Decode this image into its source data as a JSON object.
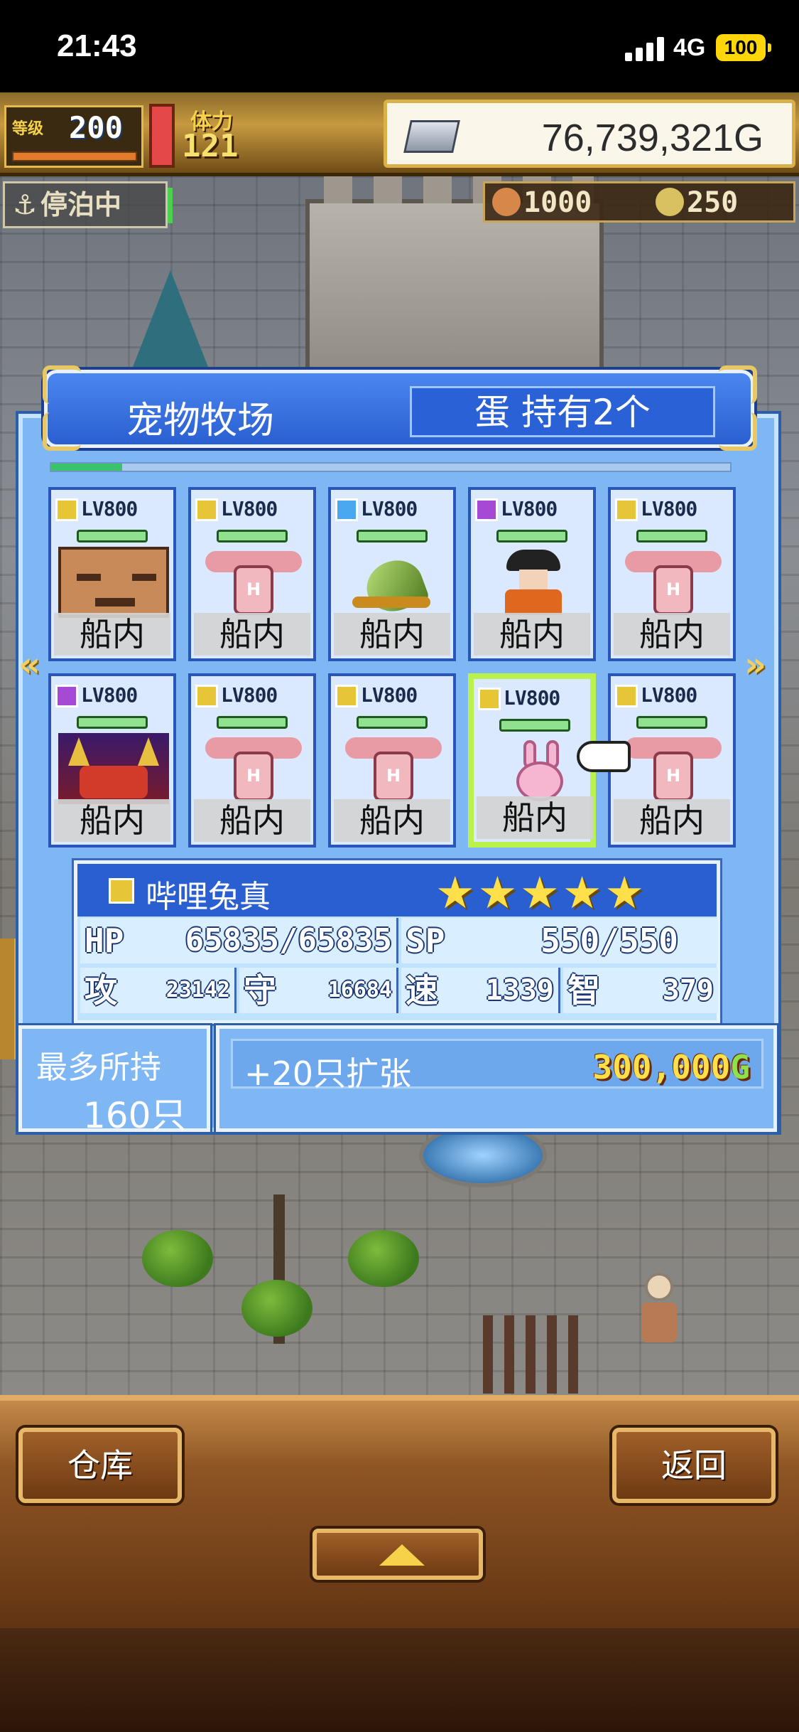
{
  "status_bar": {
    "time": "21:43",
    "network": "4G",
    "battery": "100"
  },
  "hud": {
    "level_label": "等级",
    "level": "200",
    "stamina_label": "体力",
    "stamina": "121",
    "gold": "76,739,321G",
    "dock_status": "停泊中",
    "resource_1": "1000",
    "resource_2": "250"
  },
  "panel": {
    "title": "宠物牧场",
    "egg_status": "蛋 持有2个"
  },
  "pets": [
    {
      "level": "LV800",
      "location": "船内",
      "rank": "gold",
      "art": "face"
    },
    {
      "level": "LV800",
      "location": "船内",
      "rank": "gold",
      "art": "pink"
    },
    {
      "level": "LV800",
      "location": "船内",
      "rank": "blue",
      "art": "shell"
    },
    {
      "level": "LV800",
      "location": "船内",
      "rank": "purple",
      "art": "pirate"
    },
    {
      "level": "LV800",
      "location": "船内",
      "rank": "gold",
      "art": "pink"
    },
    {
      "level": "LV800",
      "location": "船内",
      "rank": "purple",
      "art": "demon"
    },
    {
      "level": "LV800",
      "location": "船内",
      "rank": "gold",
      "art": "pink"
    },
    {
      "level": "LV800",
      "location": "船内",
      "rank": "gold",
      "art": "pink"
    },
    {
      "level": "LV800",
      "location": "船内",
      "rank": "gold",
      "art": "bunny",
      "selected": true
    },
    {
      "level": "LV800",
      "location": "船内",
      "rank": "gold",
      "art": "pink"
    }
  ],
  "selected_pet": {
    "name": "哔哩兔真",
    "stars": "★★★★★",
    "hp_label": "HP",
    "hp": "65835/65835",
    "sp_label": "SP",
    "sp": "550/550",
    "atk_label": "攻",
    "atk": "23142",
    "def_label": "守",
    "def": "16684",
    "spd_label": "速",
    "spd": "1339",
    "int_label": "智",
    "int": "379"
  },
  "capacity": {
    "label": "最多所持",
    "value": "160只"
  },
  "expand": {
    "label": "+20只扩张",
    "price": "300,000",
    "currency": "G"
  },
  "bottom": {
    "warehouse_button": "仓库",
    "back_button": "返回"
  },
  "colors": {
    "rank_gold": "#e6c637",
    "rank_blue": "#4aa8f0",
    "rank_purple": "#a64ad6",
    "selected_border": "#b9f24a"
  }
}
